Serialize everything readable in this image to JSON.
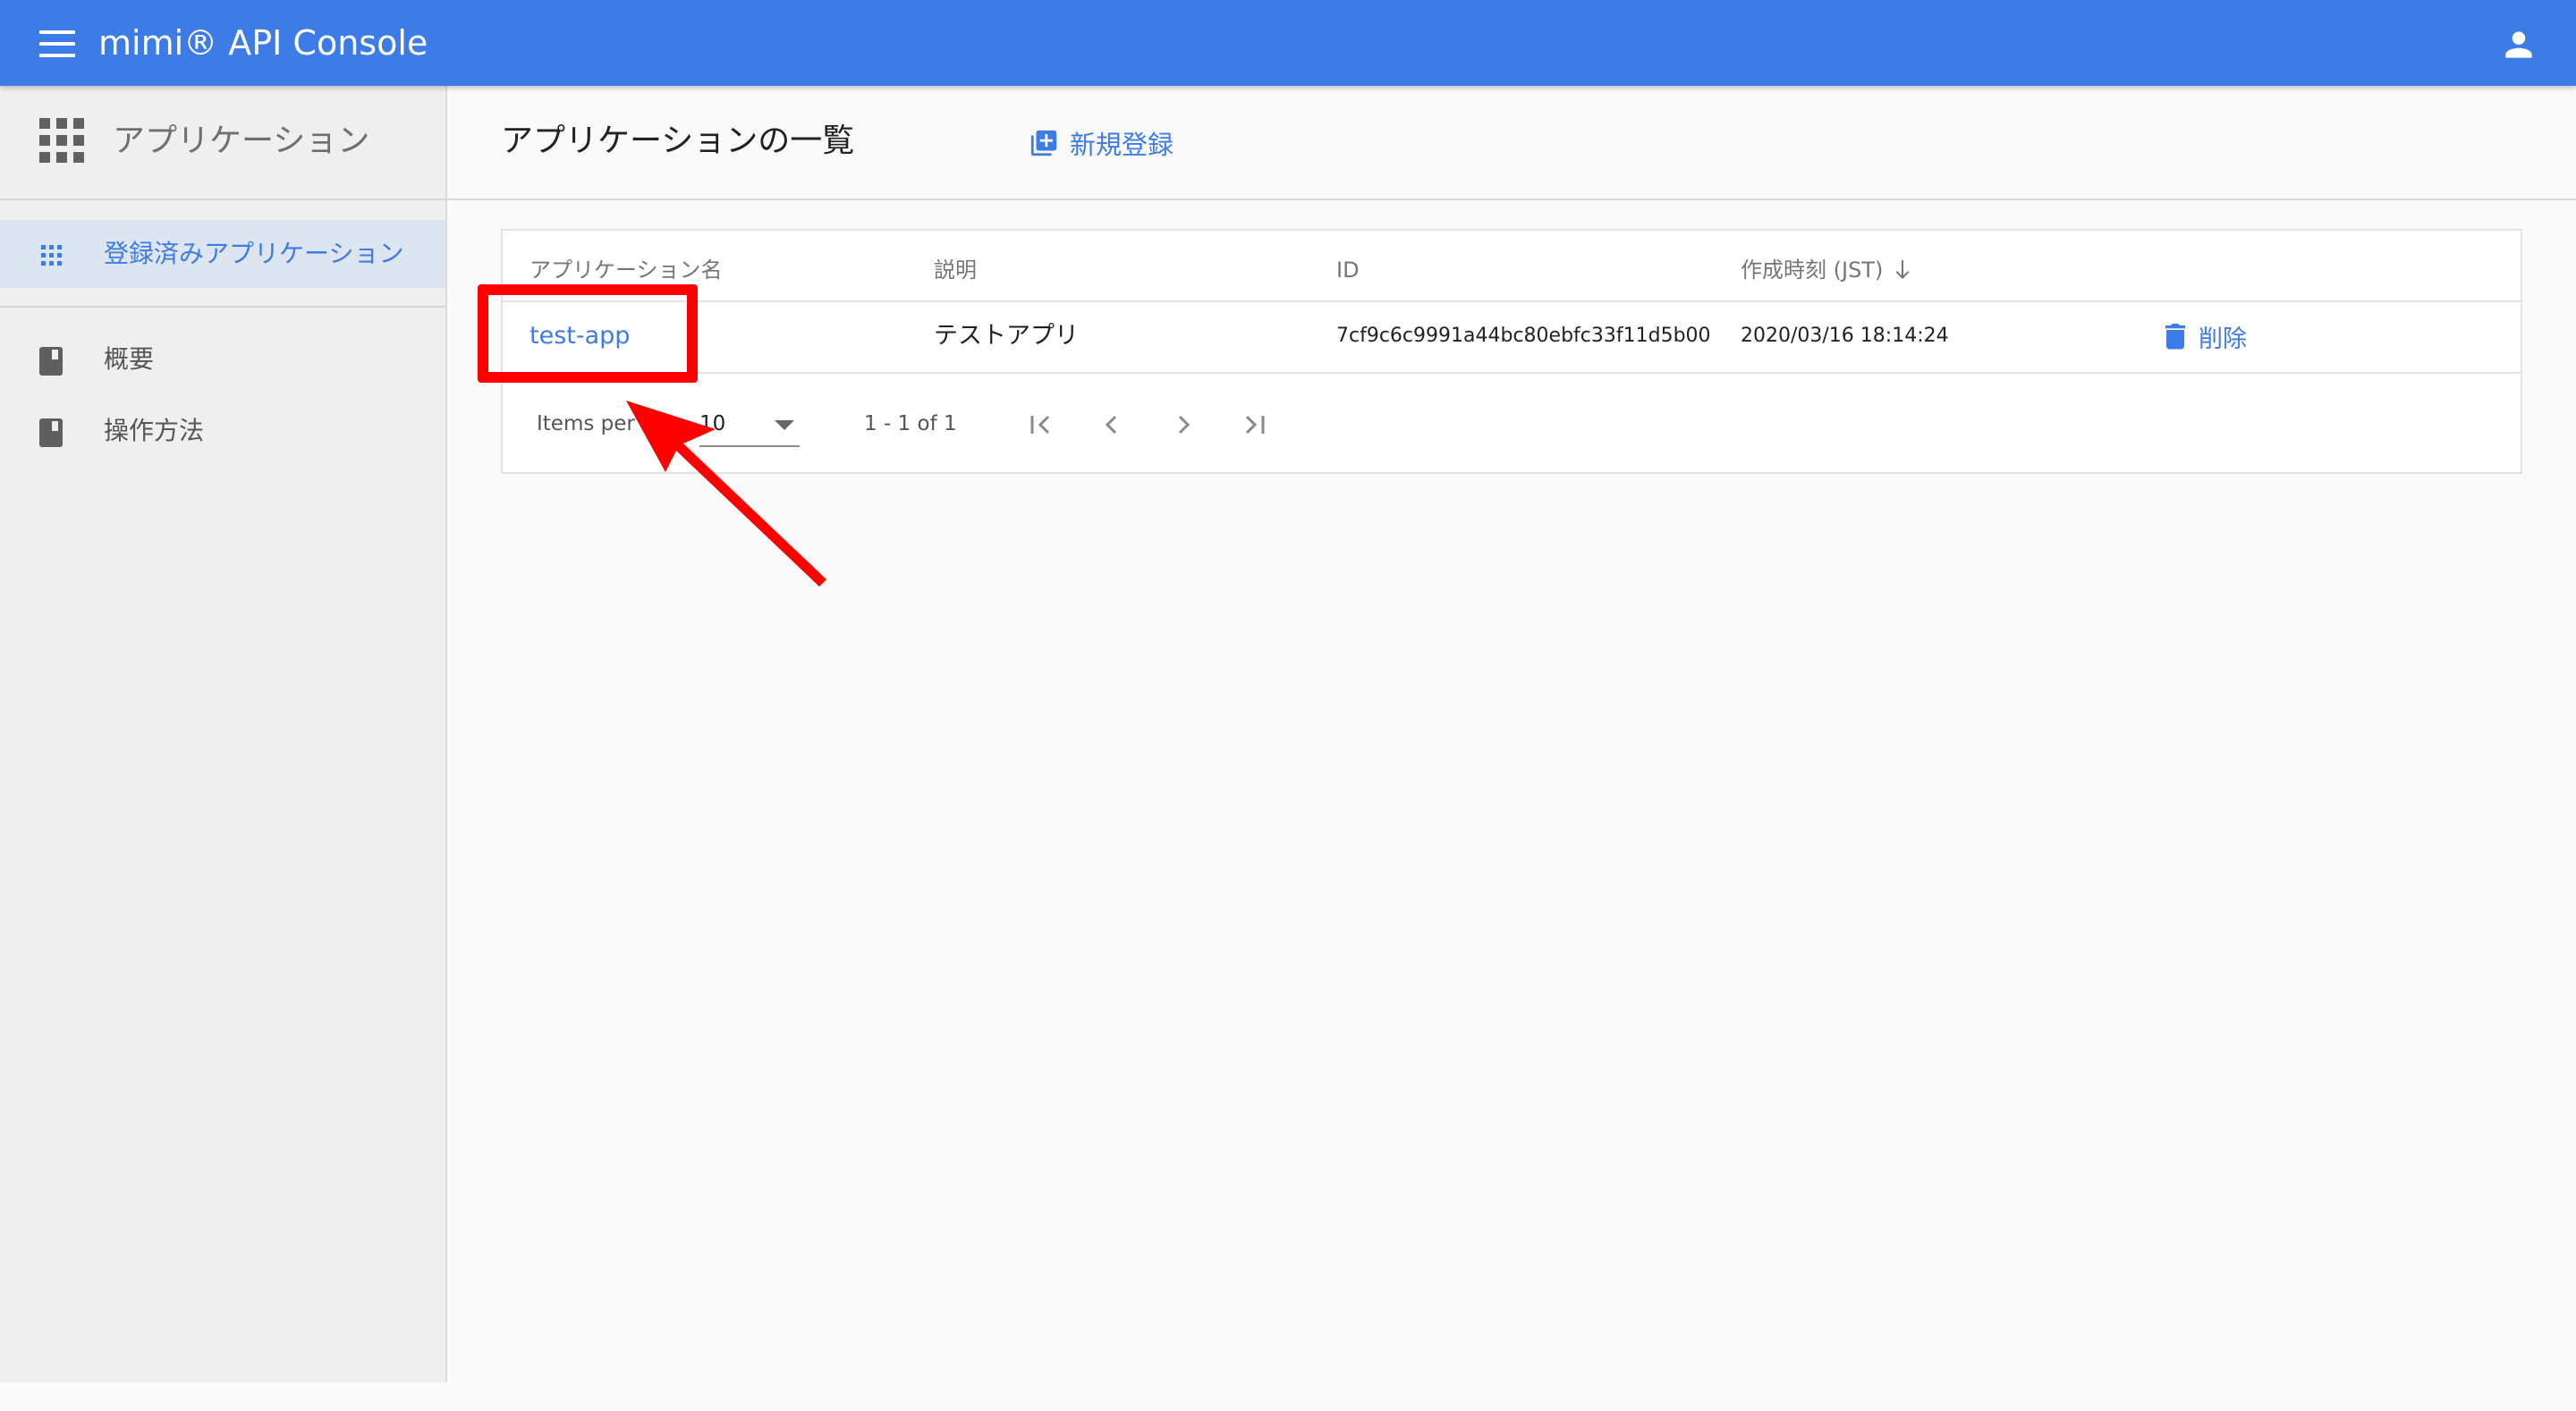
{
  "header": {
    "title": "mimi® API Console",
    "menu_icon": "hamburger-menu-icon",
    "user_icon": "account-person-icon",
    "bar_color": "#3d7be6"
  },
  "sidebar": {
    "heading": "アプリケーション",
    "heading_icon": "apps-grid-icon",
    "active_item": {
      "label": "登録済みアプリケーション",
      "icon": "apps-dots-icon"
    },
    "items": [
      {
        "label": "概要",
        "icon": "book-icon"
      },
      {
        "label": "操作方法",
        "icon": "book-icon"
      }
    ]
  },
  "main": {
    "title": "アプリケーションの一覧",
    "new_button": {
      "label": "新規登録",
      "icon": "add-box-icon"
    }
  },
  "table": {
    "columns": [
      {
        "label": "アプリケーション名"
      },
      {
        "label": "説明"
      },
      {
        "label": "ID"
      },
      {
        "label": "作成時刻 (JST)",
        "sort_icon": "arrow-down-icon"
      }
    ],
    "rows": [
      {
        "name": "test-app",
        "description": "テストアプリ",
        "id": "7cf9c6c9991a44bc80ebfc33f11d5b00",
        "created": "2020/03/16 18:14:24",
        "action": {
          "label": "削除",
          "icon": "trash-icon"
        }
      }
    ]
  },
  "paginator": {
    "items_per_page_label": "Items per",
    "items_per_page_value": "10",
    "range_label": "1 - 1 of 1",
    "nav_icons": [
      "first-page-icon",
      "previous-page-icon",
      "next-page-icon",
      "last-page-icon"
    ]
  },
  "annotation": {
    "color": "#ff0000",
    "target": "test-app"
  }
}
